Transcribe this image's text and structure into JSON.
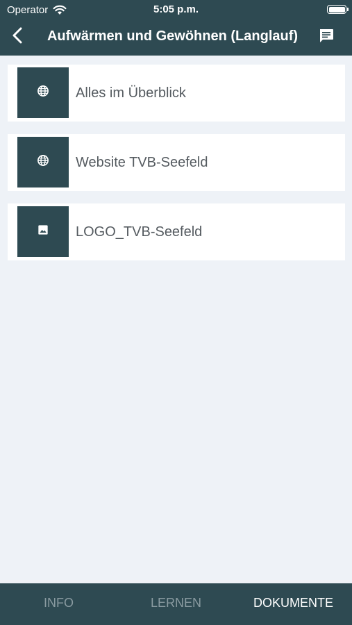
{
  "status_bar": {
    "carrier": "Operator",
    "time": "5:05 p.m.",
    "wifi_icon": "wifi-icon",
    "battery_icon": "battery-icon"
  },
  "header": {
    "back_icon": "chevron-left-icon",
    "title": "Aufwärmen und Gewöhnen (Langlauf)",
    "chat_icon": "chat-icon"
  },
  "documents": [
    {
      "label": "Alles im Überblick",
      "icon": "globe-icon"
    },
    {
      "label": "Website TVB-Seefeld",
      "icon": "globe-icon"
    },
    {
      "label": "LOGO_TVB-Seefeld",
      "icon": "image-icon"
    }
  ],
  "tabs": [
    {
      "label": "INFO",
      "active": false
    },
    {
      "label": "LERNEN",
      "active": false
    },
    {
      "label": "DOKUMENTE",
      "active": true
    }
  ],
  "colors": {
    "primary": "#2e4a52",
    "background": "#eef2f7",
    "card": "#ffffff",
    "text": "#555b60",
    "tab_inactive": "#8a9ba1",
    "tab_active": "#ffffff"
  }
}
